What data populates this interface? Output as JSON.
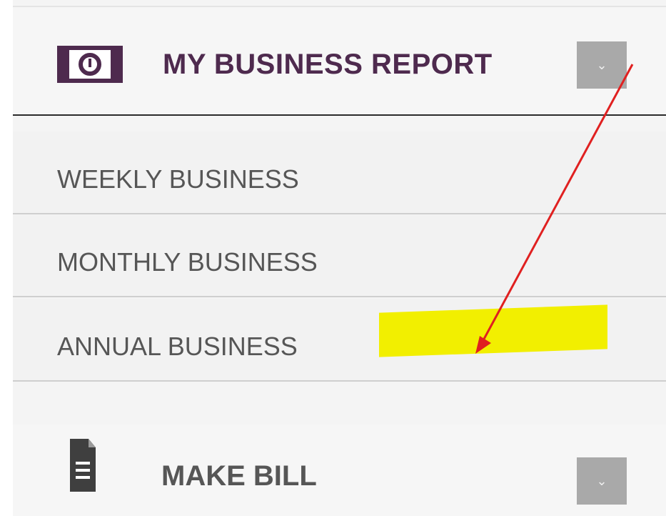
{
  "sections": [
    {
      "id": "my-business-report",
      "title": "MY BUSINESS REPORT",
      "icon": "money-icon",
      "expanded": true,
      "items": [
        {
          "label": "WEEKLY BUSINESS"
        },
        {
          "label": "MONTHLY BUSINESS"
        },
        {
          "label": "ANNUAL BUSINESS"
        }
      ]
    },
    {
      "id": "make-bill",
      "title": "MAKE BILL",
      "icon": "document-icon",
      "expanded": false
    }
  ],
  "toggle_icon": "chevron-down-icon",
  "colors": {
    "header_title": "#4e2a4e",
    "item_text": "#565656",
    "toggle_bg": "#a9a9a9",
    "highlight": "#f2ef00",
    "arrow": "#e02020"
  },
  "annotation": {
    "type": "arrow-and-highlight",
    "target": "ANNUAL BUSINESS"
  }
}
